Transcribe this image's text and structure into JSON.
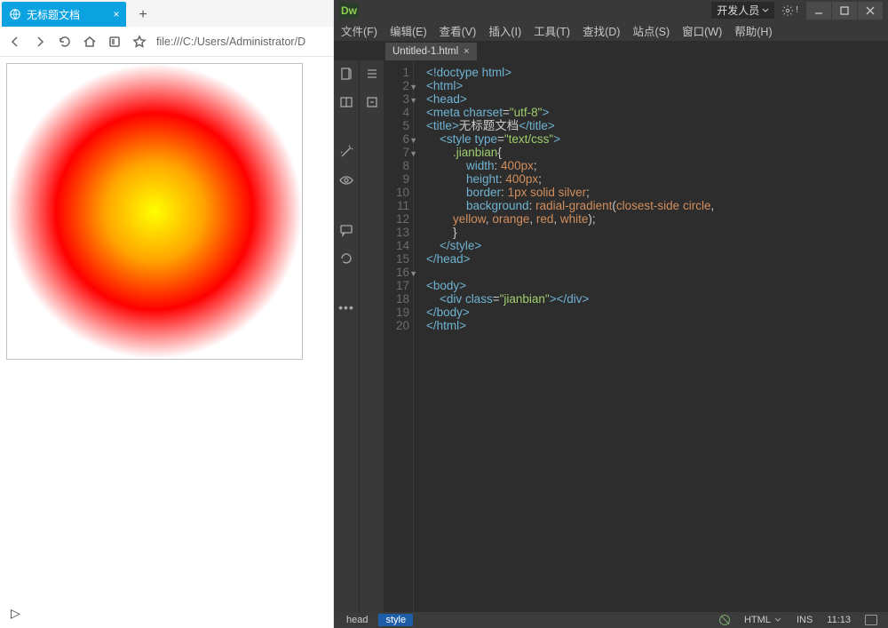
{
  "browser": {
    "tab_title": "无标题文档",
    "url": "file:///C:/Users/Administrator/D",
    "plus": "+",
    "close": "×"
  },
  "dw": {
    "logo": "Dw",
    "workspace_label": "开发人员",
    "menu": [
      "文件(F)",
      "编辑(E)",
      "查看(V)",
      "插入(I)",
      "工具(T)",
      "查找(D)",
      "站点(S)",
      "窗口(W)",
      "帮助(H)"
    ],
    "file_tab": "Untitled-1.html",
    "file_tab_close": "×",
    "code_lines": [
      {
        "n": "1",
        "fold": "",
        "html": "<span class='t-tag'>&lt;!doctype html&gt;</span>"
      },
      {
        "n": "2",
        "fold": "▼",
        "html": "<span class='t-tag'>&lt;html&gt;</span>"
      },
      {
        "n": "3",
        "fold": "▼",
        "html": "<span class='t-tag'>&lt;head&gt;</span>"
      },
      {
        "n": "4",
        "fold": "",
        "html": "<span class='t-tag'>&lt;meta</span> <span class='t-attr'>charset</span>=<span class='t-val'>\"utf-8\"</span><span class='t-tag'>&gt;</span>"
      },
      {
        "n": "5",
        "fold": "",
        "html": "<span class='t-tag'>&lt;title&gt;</span><span class='t-text'>无标题文档</span><span class='t-tag'>&lt;/title&gt;</span>"
      },
      {
        "n": "6",
        "fold": "▼",
        "html": "    <span class='t-tag'>&lt;style</span> <span class='t-attr'>type</span>=<span class='t-val'>\"text/css\"</span><span class='t-tag'>&gt;</span>"
      },
      {
        "n": "7",
        "fold": "▼",
        "html": "        <span class='t-id'>.jianbian</span>{"
      },
      {
        "n": "8",
        "fold": "",
        "html": "            <span class='t-prop'>width</span>: <span class='t-num'>400px</span>;"
      },
      {
        "n": "9",
        "fold": "",
        "html": "            <span class='t-prop'>height</span>: <span class='t-num'>400px</span>;"
      },
      {
        "n": "10",
        "fold": "",
        "html": "            <span class='t-prop'>border</span>: <span class='t-num'>1px</span> <span class='t-key'>solid</span> <span class='t-key'>silver</span>;"
      },
      {
        "n": "11",
        "fold": "",
        "html": "            <span class='t-prop'>background</span>: <span class='t-func'>radial-gradient</span>(<span class='t-key'>closest-side</span> <span class='t-key'>circle</span>,"
      },
      {
        "n": "12",
        "fold": "",
        "html": "        <span class='t-key'>yellow</span>, <span class='t-key'>orange</span>, <span class='t-key'>red</span>, <span class='t-key'>white</span>);<br>        }"
      },
      {
        "n": "13",
        "fold": "",
        "html": "    <span class='t-tag'>&lt;/style&gt;</span>"
      },
      {
        "n": "14",
        "fold": "",
        "html": "<span class='t-tag'>&lt;/head&gt;</span>"
      },
      {
        "n": "15",
        "fold": "",
        "html": ""
      },
      {
        "n": "16",
        "fold": "▼",
        "html": "<span class='t-tag'>&lt;body&gt;</span>"
      },
      {
        "n": "17",
        "fold": "",
        "html": "    <span class='t-tag'>&lt;div</span> <span class='t-attr'>class</span>=<span class='t-val'>\"jianbian\"</span><span class='t-tag'>&gt;&lt;/div&gt;</span>"
      },
      {
        "n": "18",
        "fold": "",
        "html": "<span class='t-tag'>&lt;/body&gt;</span>"
      },
      {
        "n": "19",
        "fold": "",
        "html": "<span class='t-tag'>&lt;/html&gt;</span>"
      },
      {
        "n": "20",
        "fold": "",
        "html": ""
      }
    ],
    "status": {
      "crumb1": "head",
      "crumb2": "style",
      "lang": "HTML",
      "ins": "INS",
      "pos": "11:13"
    }
  }
}
